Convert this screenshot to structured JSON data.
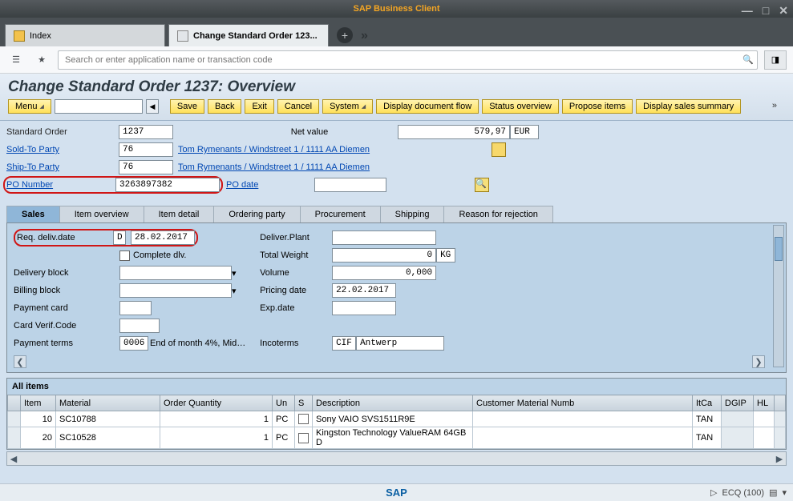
{
  "window": {
    "title": "SAP Business Client"
  },
  "apptabs": {
    "index": "Index",
    "main": "Change Standard Order 123..."
  },
  "search": {
    "placeholder": "Search or enter application name or transaction code"
  },
  "page": {
    "title": "Change Standard Order 1237: Overview"
  },
  "toolbar": {
    "menu": "Menu",
    "save": "Save",
    "back": "Back",
    "exit": "Exit",
    "cancel": "Cancel",
    "system": "System",
    "docflow": "Display document flow",
    "status": "Status overview",
    "propose": "Propose items",
    "summary": "Display sales summary"
  },
  "header": {
    "stdorder_l": "Standard Order",
    "stdorder_v": "1237",
    "netvalue_l": "Net value",
    "netvalue_v": "579,97",
    "currency": "EUR",
    "soldto_l": "Sold-To Party",
    "soldto_v": "76",
    "shipto_l": "Ship-To Party",
    "shipto_v": "76",
    "partner_link": "Tom Rymenants / Windstreet 1 / 1111 AA Diemen",
    "pono_l": "PO Number",
    "pono_v": "3263897382",
    "podate_l": "PO date"
  },
  "tabs": {
    "sales": "Sales",
    "itemov": "Item overview",
    "itemdet": "Item detail",
    "ordparty": "Ordering party",
    "proc": "Procurement",
    "ship": "Shipping",
    "reject": "Reason for rejection"
  },
  "sales": {
    "reqdate_l": "Req. deliv.date",
    "reqdate_t": "D",
    "reqdate_v": "28.02.2017",
    "complete_l": "Complete dlv.",
    "delblock_l": "Delivery block",
    "billblock_l": "Billing block",
    "paycard_l": "Payment card",
    "cardverif_l": "Card Verif.Code",
    "payterms_l": "Payment terms",
    "payterms_v": "0006",
    "payterms_d": "End of month 4%, Mid…",
    "delplant_l": "Deliver.Plant",
    "totweight_l": "Total Weight",
    "totweight_v": "0",
    "totweight_u": "KG",
    "volume_l": "Volume",
    "volume_v": "0,000",
    "pricedate_l": "Pricing date",
    "pricedate_v": "22.02.2017",
    "expdate_l": "Exp.date",
    "incoterms_l": "Incoterms",
    "incoterms_v": "CIF",
    "incoterms_d": "Antwerp"
  },
  "items": {
    "caption": "All items",
    "cols": {
      "item": "Item",
      "material": "Material",
      "qty": "Order Quantity",
      "un": "Un",
      "s": "S",
      "desc": "Description",
      "cmn": "Customer Material Numb",
      "itca": "ItCa",
      "dgip": "DGIP",
      "hl": "HL"
    },
    "rows": [
      {
        "item": "10",
        "material": "SC10788",
        "qty": "1",
        "un": "PC",
        "desc": "Sony VAIO SVS1511R9E",
        "itca": "TAN"
      },
      {
        "item": "20",
        "material": "SC10528",
        "qty": "1",
        "un": "PC",
        "desc": "Kingston Technology ValueRAM 64GB D",
        "itca": "TAN"
      }
    ]
  },
  "status": {
    "sap": "SAP",
    "ecq": "ECQ (100)"
  }
}
